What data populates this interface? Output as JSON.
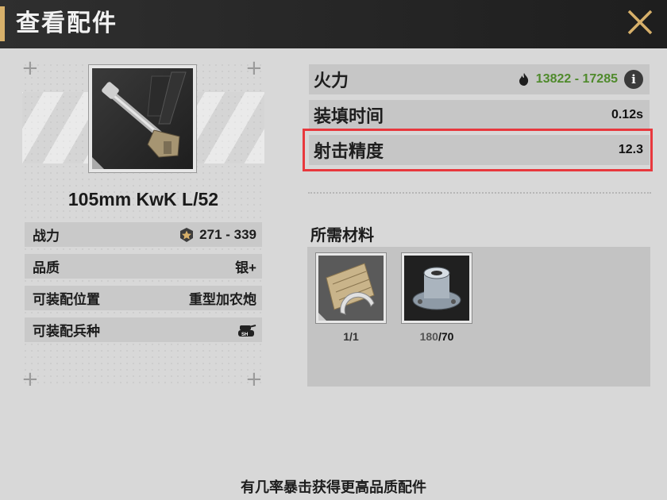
{
  "header": {
    "title": "查看配件"
  },
  "item": {
    "name": "105mm KwK L/52",
    "stats": [
      {
        "label": "战力",
        "value": "271 - 339",
        "icon": "star-badge-icon"
      },
      {
        "label": "品质",
        "value": "银+"
      },
      {
        "label": "可装配位置",
        "value": "重型加农炮"
      },
      {
        "label": "可装配兵种",
        "value": "",
        "icon": "tank-sh-icon"
      }
    ]
  },
  "attributes": [
    {
      "label": "火力",
      "value": "13822 - 17285",
      "icon": "fire-icon",
      "info": "i"
    },
    {
      "label": "装填时间",
      "value": "0.12s"
    },
    {
      "label": "射击精度",
      "value": "12.3"
    }
  ],
  "materials": {
    "title": "所需材料",
    "items": [
      {
        "name": "blueprint",
        "count": "1/1"
      },
      {
        "name": "gear-part",
        "have": "180",
        "need": "/70"
      }
    ]
  },
  "footer": {
    "note": "有几率暴击获得更高品质配件"
  },
  "colors": {
    "accent": "#d7b06a",
    "fire_value": "#4f8a2c",
    "highlight": "#e8383d"
  }
}
